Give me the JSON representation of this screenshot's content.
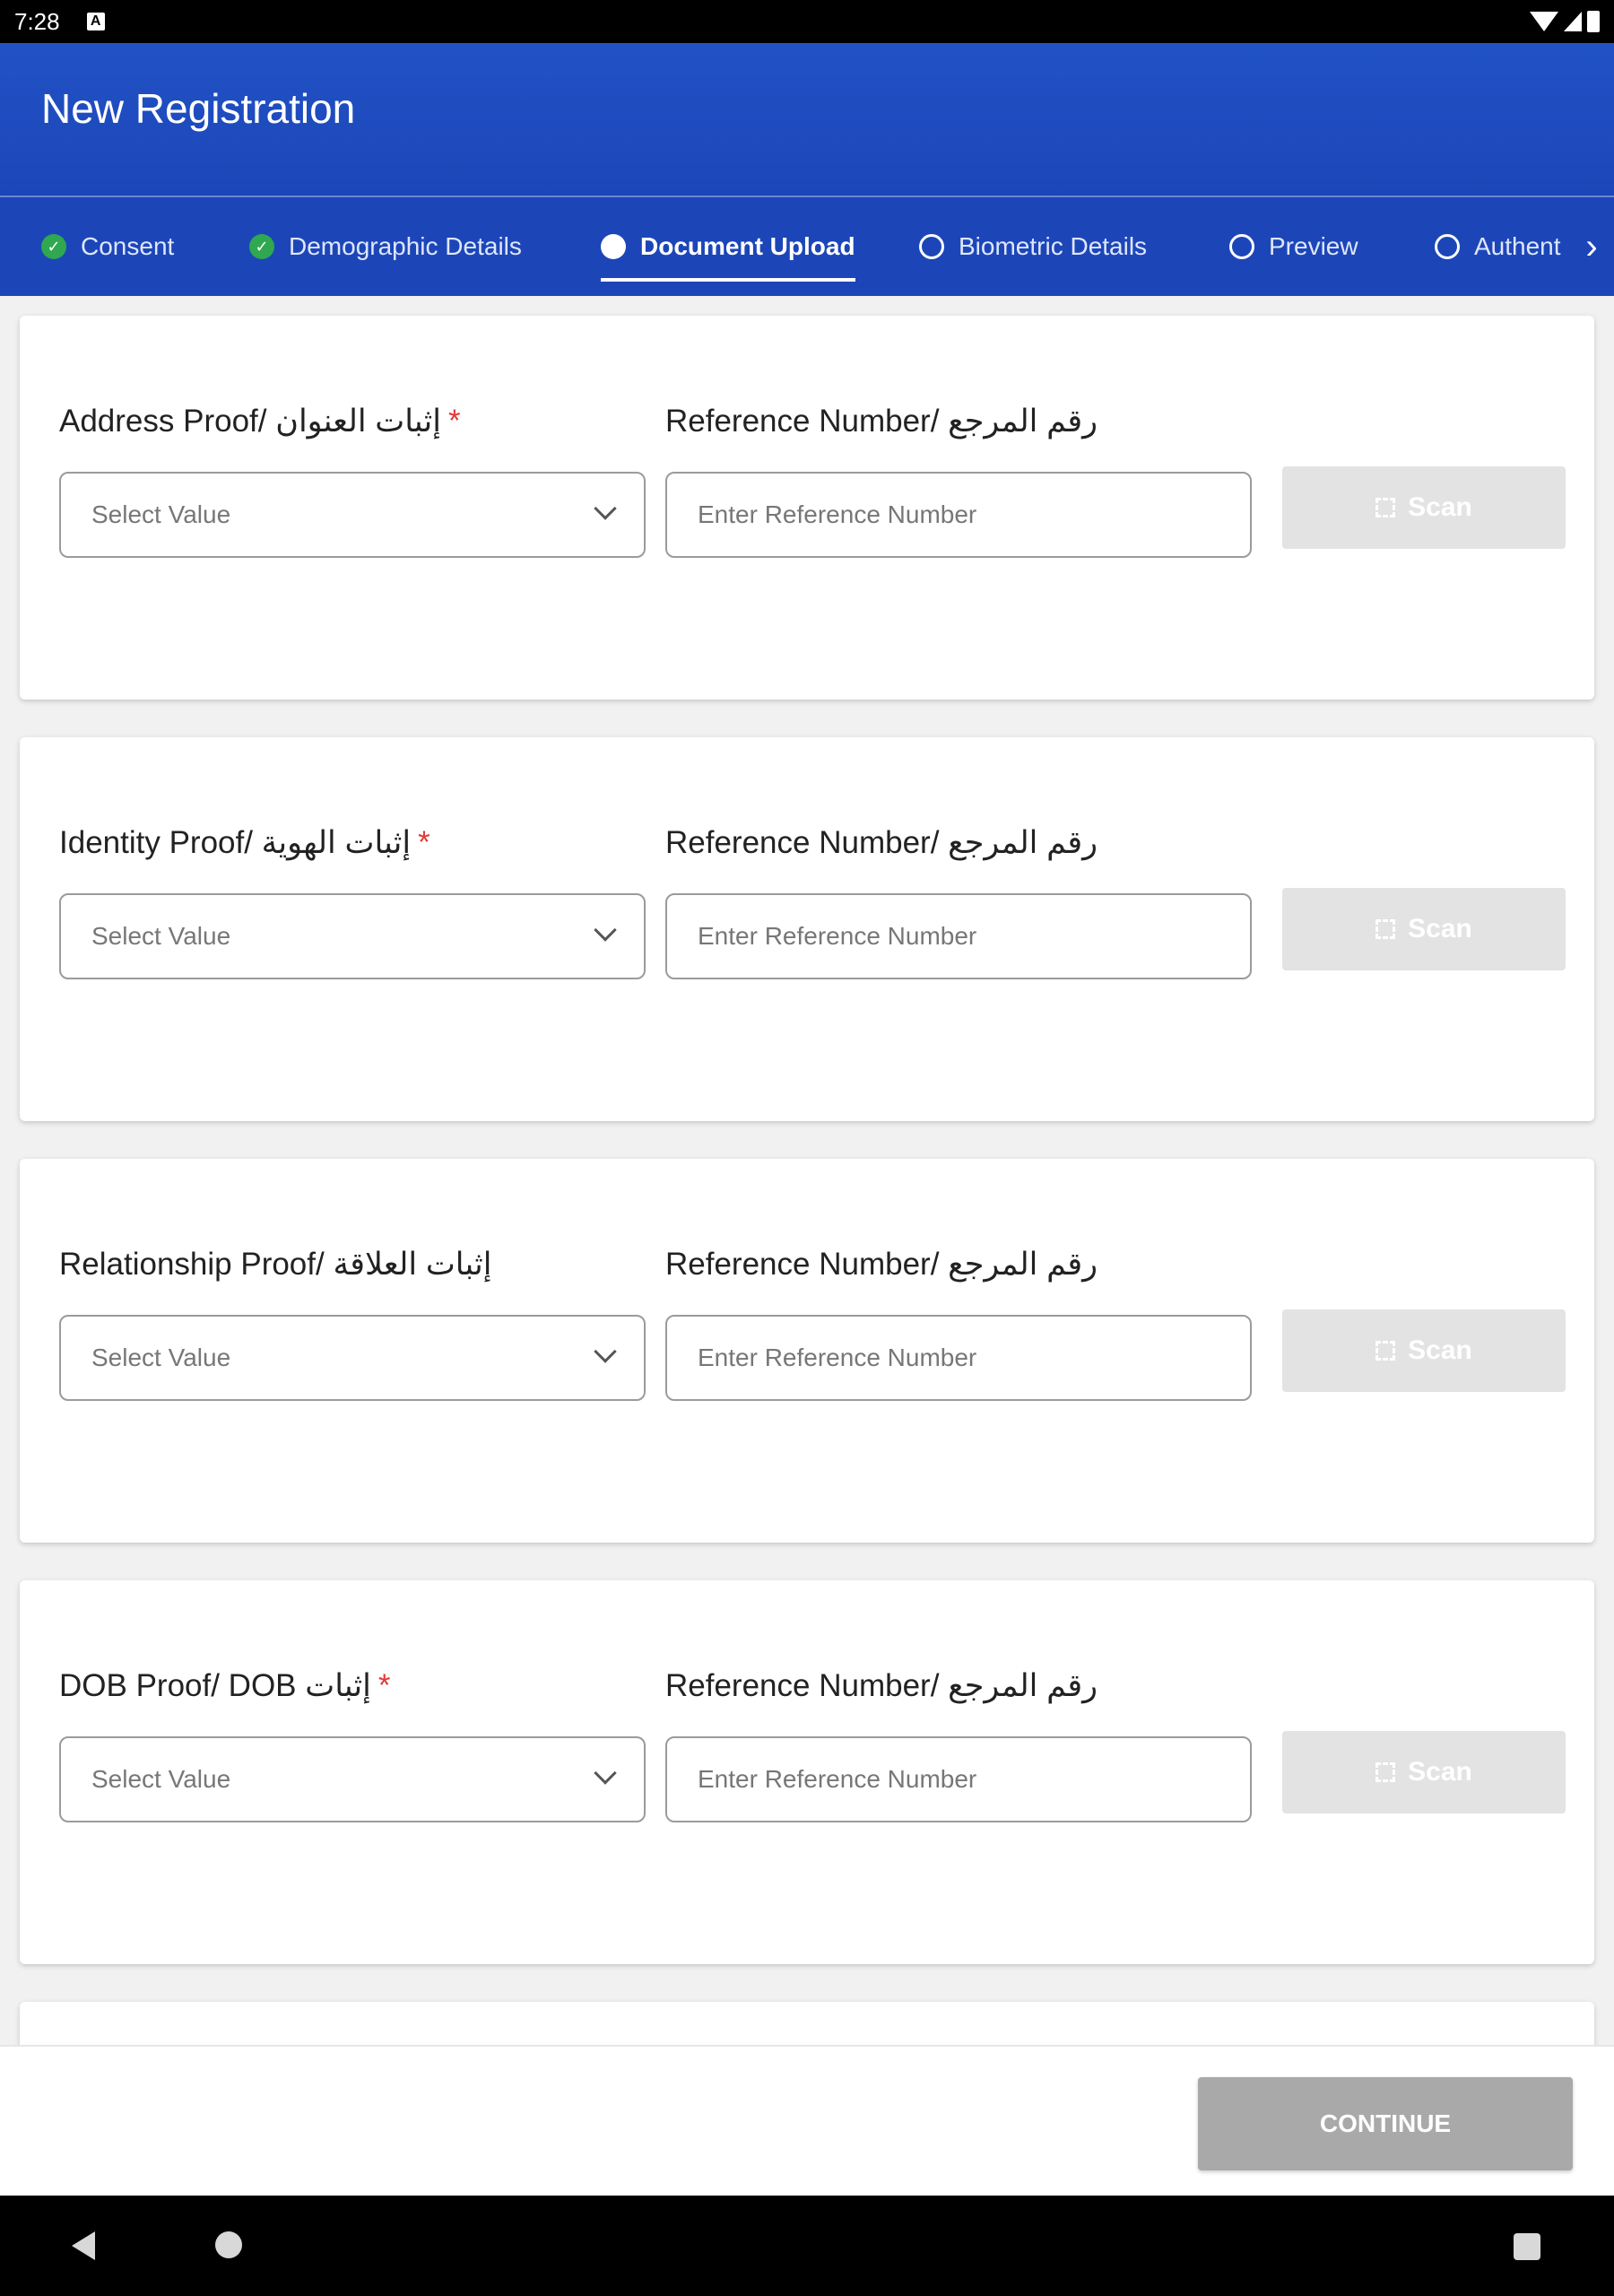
{
  "status_bar": {
    "time": "7:28",
    "notification_icon": "A"
  },
  "app_bar": {
    "title": "New Registration"
  },
  "tabs": [
    {
      "label": "Consent",
      "state": "completed"
    },
    {
      "label": "Demographic Details",
      "state": "completed"
    },
    {
      "label": "Document Upload",
      "state": "active"
    },
    {
      "label": "Biometric Details",
      "state": "pending"
    },
    {
      "label": "Preview",
      "state": "pending"
    },
    {
      "label": "Authent",
      "state": "pending"
    }
  ],
  "documents": [
    {
      "label": "Address Proof/ إثبات العنوان",
      "required": "*",
      "ref_label": "Reference Number/ رقم المرجع",
      "select_placeholder": "Select Value",
      "ref_placeholder": "Enter Reference Number",
      "scan_label": "Scan"
    },
    {
      "label": "Identity Proof/ إثبات الهوية",
      "required": "*",
      "ref_label": "Reference Number/ رقم المرجع",
      "select_placeholder": "Select Value",
      "ref_placeholder": "Enter Reference Number",
      "scan_label": "Scan"
    },
    {
      "label": "Relationship Proof/ إثبات العلاقة",
      "required": "",
      "ref_label": "Reference Number/ رقم المرجع",
      "select_placeholder": "Select Value",
      "ref_placeholder": "Enter Reference Number",
      "scan_label": "Scan"
    },
    {
      "label": "DOB Proof/ DOB إثبات",
      "required": "*",
      "ref_label": "Reference Number/ رقم المرجع",
      "select_placeholder": "Select Value",
      "ref_placeholder": "Enter Reference Number",
      "scan_label": "Scan"
    }
  ],
  "footer": {
    "continue_label": "CONTINUE"
  },
  "colors": {
    "primary": "#1c46b8",
    "check": "#2fa84f",
    "required": "#e23a3a",
    "disabled": "#a9a9a9"
  }
}
